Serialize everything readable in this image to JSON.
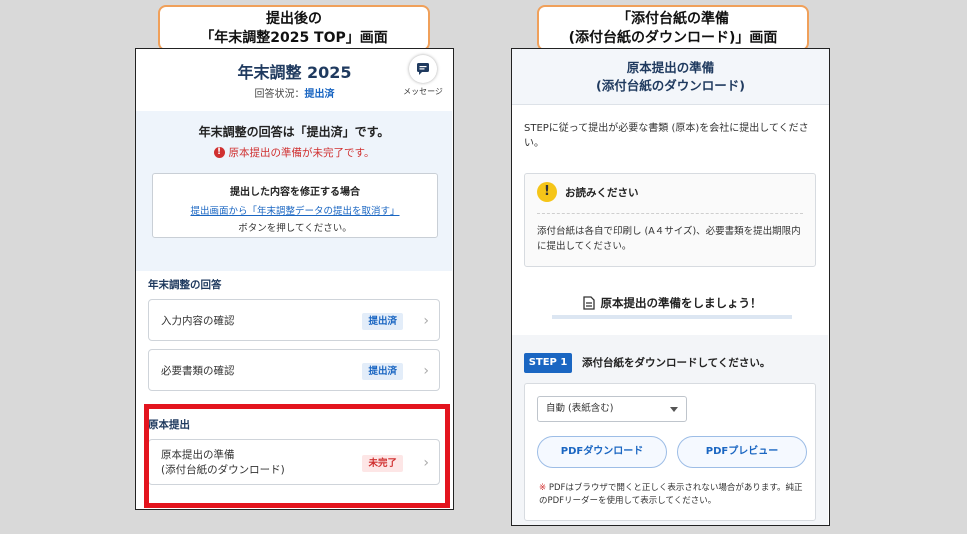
{
  "callouts": {
    "left": {
      "line1": "提出後の",
      "line2": "「年末調整2025 TOP」画面"
    },
    "right": {
      "line1": "「添付台紙の準備",
      "line2": "(添付台紙のダウンロード)」画面"
    }
  },
  "left_screen": {
    "title": "年末調整 2025",
    "status_label": "回答状況：",
    "status_value": "提出済",
    "message_button": {
      "label": "メッセージ",
      "icon": "chat-icon"
    },
    "banner": {
      "text": "年末調整の回答は「提出済」です。",
      "warning": "原本提出の準備が未完了です。",
      "fix_box": {
        "title": "提出した内容を修正する場合",
        "link": "提出画面から「年末調整データの提出を取消す」",
        "note": "ボタンを押してください。"
      }
    },
    "section_answers": {
      "label": "年末調整の回答",
      "items": [
        {
          "label": "入力内容の確認",
          "badge": "提出済"
        },
        {
          "label": "必要書類の確認",
          "badge": "提出済"
        }
      ]
    },
    "section_original": {
      "label": "原本提出",
      "items": [
        {
          "line1": "原本提出の準備",
          "line2": "(添付台紙のダウンロード)",
          "badge": "未完了"
        }
      ]
    },
    "colors": {
      "accent": "#1a66c2",
      "alert": "#d03030",
      "highlight_border": "#e3141e"
    }
  },
  "right_screen": {
    "title_line1": "原本提出の準備",
    "title_line2": "(添付台紙のダウンロード)",
    "intro": "STEPに従って提出が必要な書類 (原本)を会社に提出してください。",
    "notice": {
      "heading": "お読みください",
      "body": "添付台紙は各自で印刷し (A４サイズ)、必要書類を提出期限内に提出してください。"
    },
    "prep_heading": "原本提出の準備をしましょう！",
    "step": {
      "badge": "STEP 1",
      "text": "添付台紙をダウンロードしてください。",
      "select_value": "自動 (表紙含む)",
      "download_button": "PDFダウンロード",
      "preview_button": "PDFプレビュー",
      "note_mark": "※",
      "note": "PDFはブラウザで開くと正しく表示されない場合があります。純正のPDFリーダーを使用して表示してください。"
    }
  }
}
